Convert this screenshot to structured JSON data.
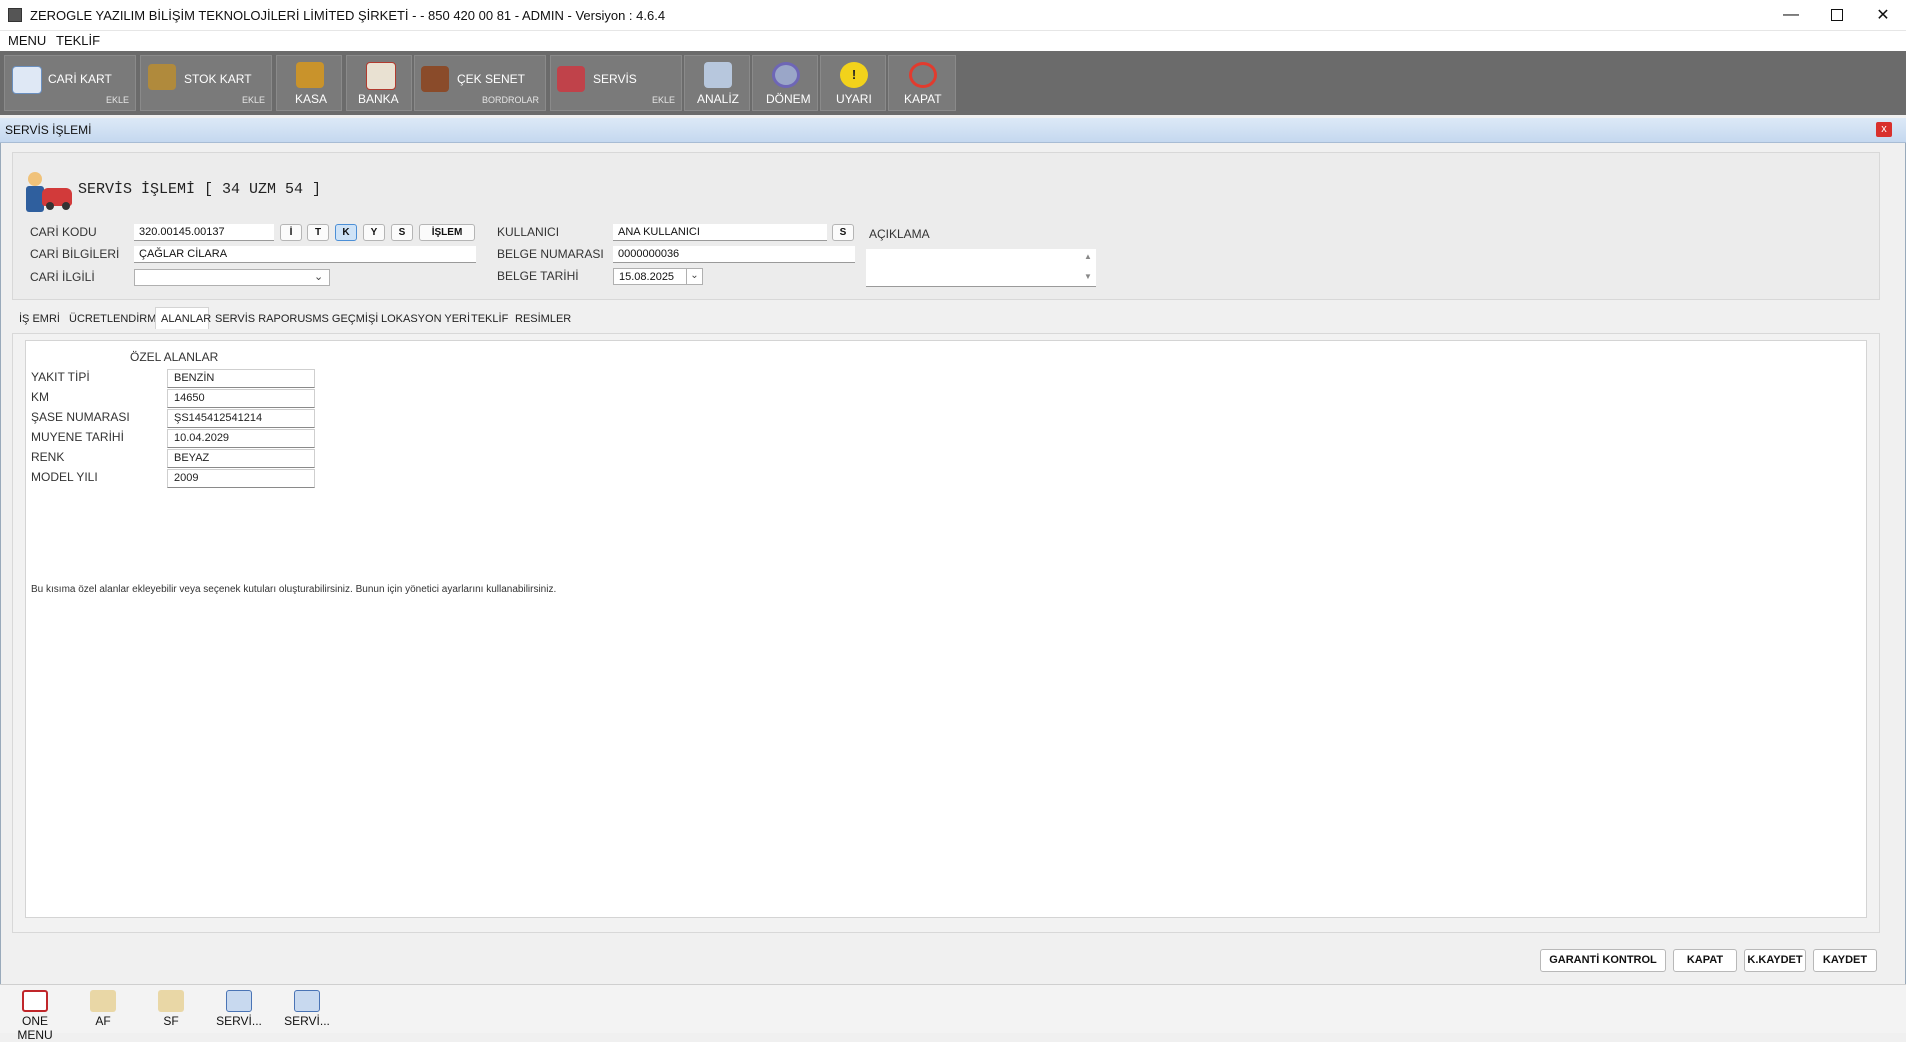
{
  "window": {
    "title": "ZEROGLE YAZILIM BİLİŞİM TEKNOLOJİLERİ LİMİTED ŞİRKETİ -  - 850 420 00 81 - ADMIN - Versiyon : 4.6.4",
    "minimize_icon": "minimize-icon",
    "maximize_icon": "maximize-icon",
    "close_icon": "close-icon"
  },
  "menubar": {
    "items": [
      "MENU",
      "TEKLİF"
    ]
  },
  "toolbar": {
    "buttons": [
      {
        "label": "CARİ KART",
        "sub": "EKLE",
        "icon": "id-card-icon"
      },
      {
        "label": "STOK KART",
        "sub": "EKLE",
        "icon": "box-icon"
      },
      {
        "label": "KASA",
        "sub": "",
        "icon": "safe-icon"
      },
      {
        "label": "BANKA",
        "sub": "",
        "icon": "bank-icon"
      },
      {
        "label": "ÇEK SENET",
        "sub": "BORDROLAR",
        "icon": "briefcase-icon"
      },
      {
        "label": "SERVİS",
        "sub": "EKLE",
        "icon": "car-service-icon"
      },
      {
        "label": "ANALİZ",
        "sub": "",
        "icon": "documents-icon"
      },
      {
        "label": "DÖNEM",
        "sub": "",
        "icon": "refresh-icon"
      },
      {
        "label": "UYARI",
        "sub": "",
        "icon": "warning-icon"
      },
      {
        "label": "KAPAT",
        "sub": "",
        "icon": "power-icon"
      }
    ]
  },
  "form": {
    "title": "SERVİS İŞLEMİ",
    "close": "x",
    "heading": "SERVİS İŞLEMİ [ 34 UZM 54 ]",
    "cari_kodu_label": "CARİ KODU",
    "cari_kodu_value": "320.00145.00137",
    "cari_buttons": [
      "İ",
      "T",
      "K",
      "Y",
      "S",
      "İŞLEM"
    ],
    "cari_bilgileri_label": "CARİ BİLGİLERİ",
    "cari_bilgileri_value": "ÇAĞLAR CİLARA",
    "cari_ilgili_label": "CARİ İLGİLİ",
    "cari_ilgili_value": "",
    "kullanici_label": "KULLANICI",
    "kullanici_value": "ANA KULLANICI",
    "kullanici_button": "S",
    "belge_numarasi_label": "BELGE NUMARASI",
    "belge_numarasi_value": "0000000036",
    "belge_tarihi_label": "BELGE TARİHİ",
    "belge_tarihi_value": "15.08.2025",
    "aciklama_label": "AÇIKLAMA",
    "aciklama_value": ""
  },
  "tabs": {
    "items": [
      "İŞ EMRİ",
      "ÜCRETLENDİRME",
      "ALANLAR",
      "SERVİS RAPORU",
      "SMS GEÇMİŞİ",
      "LOKASYON YERİ",
      "TEKLİF",
      "RESİMLER"
    ],
    "active": "ALANLAR"
  },
  "custom_fields": {
    "title": "ÖZEL ALANLAR",
    "fields": [
      {
        "label": "YAKIT TİPİ",
        "value": "BENZİN"
      },
      {
        "label": "KM",
        "value": "14650"
      },
      {
        "label": "ŞASE NUMARASI",
        "value": "ŞS145412541214"
      },
      {
        "label": "MUYENE TARİHİ",
        "value": "10.04.2029"
      },
      {
        "label": "RENK",
        "value": "BEYAZ"
      },
      {
        "label": "MODEL YILI",
        "value": "2009"
      }
    ],
    "note": "Bu kısıma özel alanlar ekleyebilir veya seçenek kutuları oluşturabilirsiniz. Bunun için yönetici ayarlarını kullanabilirsiniz."
  },
  "actions": {
    "garanti": "GARANTİ KONTROL",
    "kapat": "KAPAT",
    "kkaydet": "K.KAYDET",
    "kaydet": "KAYDET"
  },
  "taskbar": {
    "items": [
      {
        "label": "ONE MENU",
        "icon": "menu-list-icon"
      },
      {
        "label": "AF",
        "icon": "invoice-icon"
      },
      {
        "label": "SF",
        "icon": "invoice-icon"
      },
      {
        "label": "SERVİ...",
        "icon": "window-icon"
      },
      {
        "label": "SERVİ...",
        "icon": "window-icon"
      }
    ]
  },
  "colors": {
    "toolbar_bg": "#6b6b6b",
    "form_title_bg": "#c5d8ef",
    "close_red": "#d9302c"
  }
}
